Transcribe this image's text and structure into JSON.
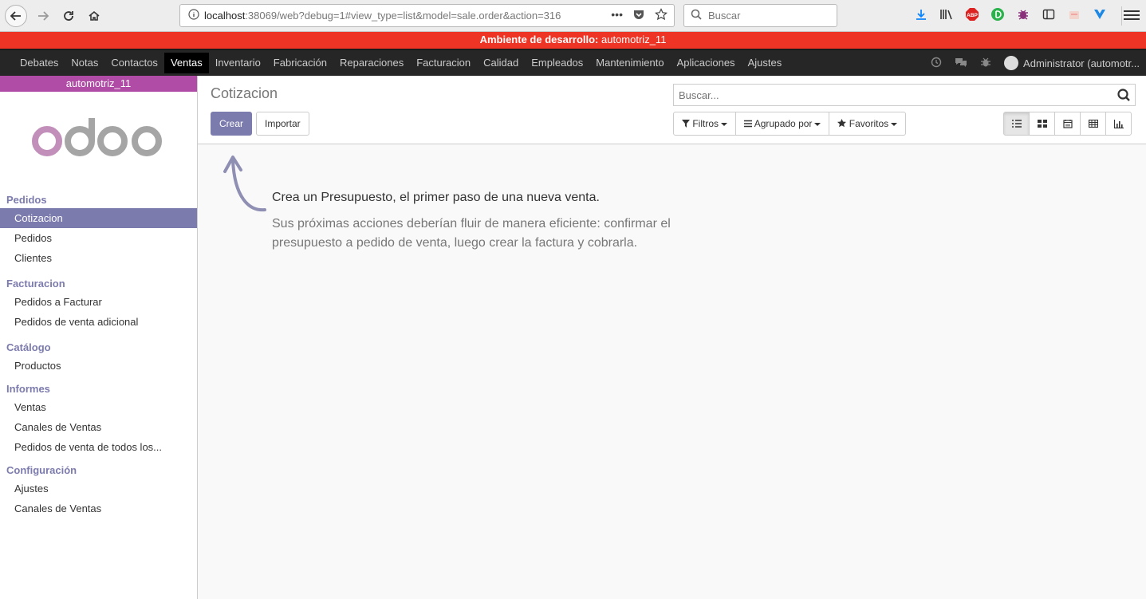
{
  "browser": {
    "url_host": "localhost",
    "url_rest": ":38069/web?debug=1#view_type=list&model=sale.order&action=316",
    "search_placeholder": "Buscar",
    "more_label": "•••"
  },
  "dev_banner": {
    "label": "Ambiente de desarrollo:",
    "db": " automotriz_11"
  },
  "main_menu": {
    "items": [
      "Debates",
      "Notas",
      "Contactos",
      "Ventas",
      "Inventario",
      "Fabricación",
      "Reparaciones",
      "Facturacion",
      "Calidad",
      "Empleados",
      "Mantenimiento",
      "Aplicaciones",
      "Ajustes"
    ],
    "active_index": 3,
    "user": "Administrator (automotr..."
  },
  "sidebar": {
    "db_name": "automotriz_11",
    "logo_text": "odoo",
    "sections": [
      {
        "title": "Pedidos",
        "items": [
          "Cotizacion",
          "Pedidos",
          "Clientes"
        ]
      },
      {
        "title": "Facturacion",
        "items": [
          "Pedidos a Facturar",
          "Pedidos de venta adicional"
        ]
      },
      {
        "title": "Catálogo",
        "items": [
          "Productos"
        ]
      },
      {
        "title": "Informes",
        "items": [
          "Ventas",
          "Canales de Ventas",
          "Pedidos de venta de todos los..."
        ]
      },
      {
        "title": "Configuración",
        "items": [
          "Ajustes",
          "Canales de Ventas"
        ]
      }
    ],
    "active_item": "Cotizacion"
  },
  "control_panel": {
    "title": "Cotizacion",
    "create_label": "Crear",
    "import_label": "Importar",
    "search_placeholder": "Buscar...",
    "filters_label": "Filtros",
    "group_label": "Agrupado por",
    "favorites_label": "Favoritos",
    "active_view": "list"
  },
  "help": {
    "title": "Crea un Presupuesto, el primer paso de una nueva venta.",
    "text": "Sus próximas acciones deberían fluir de manera eficiente: confirmar el presupuesto a pedido de venta, luego crear la factura y cobrarla."
  },
  "colors": {
    "brand": "#7c7bad",
    "db_bar": "#b04ba6",
    "dev_banner": "#ee3424",
    "menu_bg": "#262626"
  }
}
